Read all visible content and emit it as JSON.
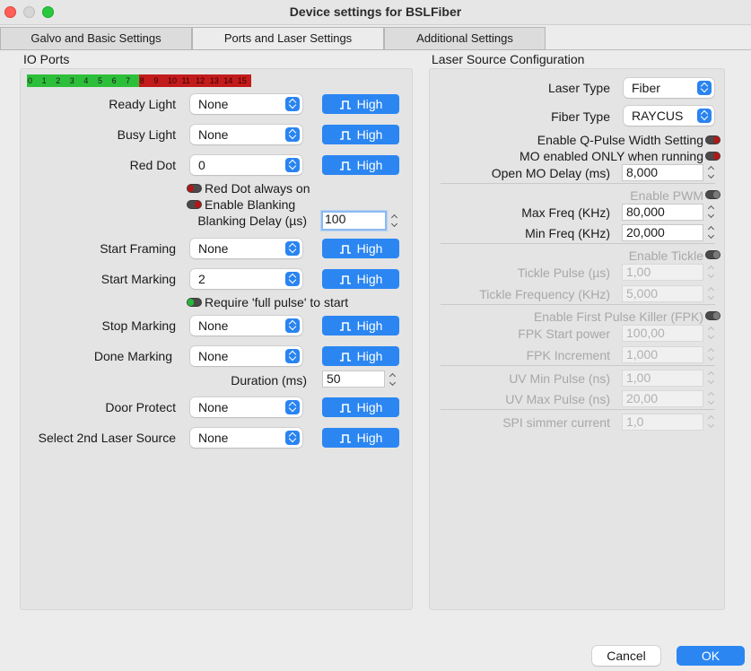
{
  "window": {
    "title": "Device settings for BSLFiber"
  },
  "tabs": [
    {
      "label": "Galvo and Basic Settings",
      "active": false
    },
    {
      "label": "Ports and Laser Settings",
      "active": true
    },
    {
      "label": "Additional Settings",
      "active": false
    }
  ],
  "io": {
    "title": "IO Ports",
    "ports": [
      {
        "label": "0",
        "state": "on"
      },
      {
        "label": "1",
        "state": "on"
      },
      {
        "label": "2",
        "state": "on"
      },
      {
        "label": "3",
        "state": "on"
      },
      {
        "label": "4",
        "state": "on"
      },
      {
        "label": "5",
        "state": "on"
      },
      {
        "label": "6",
        "state": "on"
      },
      {
        "label": "7",
        "state": "on"
      },
      {
        "label": "8",
        "state": "off"
      },
      {
        "label": "9",
        "state": "off"
      },
      {
        "label": "10",
        "state": "off"
      },
      {
        "label": "11",
        "state": "off"
      },
      {
        "label": "12",
        "state": "off"
      },
      {
        "label": "13",
        "state": "off"
      },
      {
        "label": "14",
        "state": "off"
      },
      {
        "label": "15",
        "state": "off"
      }
    ],
    "high_label": "High",
    "rows": {
      "ready_light": {
        "label": "Ready Light",
        "value": "None"
      },
      "busy_light": {
        "label": "Busy Light",
        "value": "None"
      },
      "red_dot": {
        "label": "Red Dot",
        "value": "0"
      },
      "start_framing": {
        "label": "Start Framing",
        "value": "None"
      },
      "start_marking": {
        "label": "Start Marking",
        "value": "2"
      },
      "stop_marking": {
        "label": "Stop Marking",
        "value": "None"
      },
      "done_marking": {
        "label": "Done Marking",
        "value": "None"
      },
      "door_protect": {
        "label": "Door Protect",
        "value": "None"
      },
      "second_laser": {
        "label": "Select 2nd Laser Source",
        "value": "None"
      }
    },
    "red_dot_always_on": "Red Dot always on",
    "enable_blanking": "Enable Blanking",
    "blanking_delay": {
      "label": "Blanking Delay (µs)",
      "value": "100"
    },
    "require_full_pulse": "Require 'full pulse' to start",
    "duration": {
      "label": "Duration (ms)",
      "value": "50"
    }
  },
  "laser": {
    "title": "Laser Source Configuration",
    "laser_type": {
      "label": "Laser Type",
      "value": "Fiber"
    },
    "fiber_type": {
      "label": "Fiber Type",
      "value": "RAYCUS"
    },
    "enable_qpulse": "Enable Q-Pulse Width Setting",
    "mo_only_running": "MO enabled ONLY when running",
    "open_mo_delay": {
      "label": "Open MO Delay (ms)",
      "value": "8,000"
    },
    "enable_pwm": "Enable PWM",
    "max_freq": {
      "label": "Max Freq (KHz)",
      "value": "80,000"
    },
    "min_freq": {
      "label": "Min Freq (KHz)",
      "value": "20,000"
    },
    "enable_tickle": "Enable Tickle",
    "tickle_pulse": {
      "label": "Tickle Pulse (µs)",
      "value": "1,00"
    },
    "tickle_freq": {
      "label": "Tickle Frequency (KHz)",
      "value": "5,000"
    },
    "enable_fpk": "Enable First Pulse Killer (FPK)",
    "fpk_start": {
      "label": "FPK Start power",
      "value": "100,00"
    },
    "fpk_increment": {
      "label": "FPK Increment",
      "value": "1,000"
    },
    "uv_min": {
      "label": "UV Min Pulse (ns)",
      "value": "1,00"
    },
    "uv_max": {
      "label": "UV Max Pulse (ns)",
      "value": "20,00"
    },
    "spi_simmer": {
      "label": "SPI simmer current",
      "value": "1,0"
    }
  },
  "footer": {
    "cancel": "Cancel",
    "ok": "OK"
  }
}
